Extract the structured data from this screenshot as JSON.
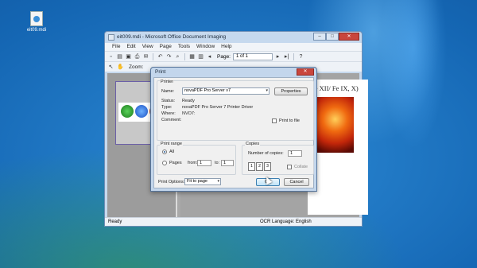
{
  "desktop": {
    "icon_label": "eit09.mdi"
  },
  "app": {
    "title": "eit009.mdi - Microsoft Office Document Imaging",
    "buttons": {
      "minimize": "–",
      "maximize": "□",
      "close": "✕"
    },
    "menu": [
      "File",
      "Edit",
      "View",
      "Page",
      "Tools",
      "Window",
      "Help"
    ],
    "toolbar": {
      "page_label": "Page:",
      "page_value": "1 of 1",
      "zoom_label": "Zoom:"
    },
    "document_text": "Fe XII/ Fe IX, X)",
    "statusbar": {
      "left": "Ready",
      "right": "OCR Language: English"
    }
  },
  "print_dialog": {
    "title": "Print",
    "close": "✕",
    "printer": {
      "section": "Printer",
      "name_label": "Name:",
      "name_value": "novaPDF Pro Server v7",
      "properties_button": "Properties",
      "status_label": "Status:",
      "status_value": "Ready",
      "type_label": "Type:",
      "type_value": "novaPDF Pro Server 7 Printer Driver",
      "where_label": "Where:",
      "where_value": "NVO7:",
      "comment_label": "Comment:",
      "print_to_file": "Print to file"
    },
    "print_range": {
      "section": "Print range",
      "all": "All",
      "pages": "Pages",
      "from_label": "from:",
      "from_value": "1",
      "to_label": "to:",
      "to_value": "1"
    },
    "copies": {
      "section": "Copies",
      "number_label": "Number of copies:",
      "number_value": "1",
      "collate": "Collate"
    },
    "options_label": "Print Options:",
    "options_value": "Fit to page",
    "ok_button": "OK",
    "cancel_button": "Cancel"
  }
}
